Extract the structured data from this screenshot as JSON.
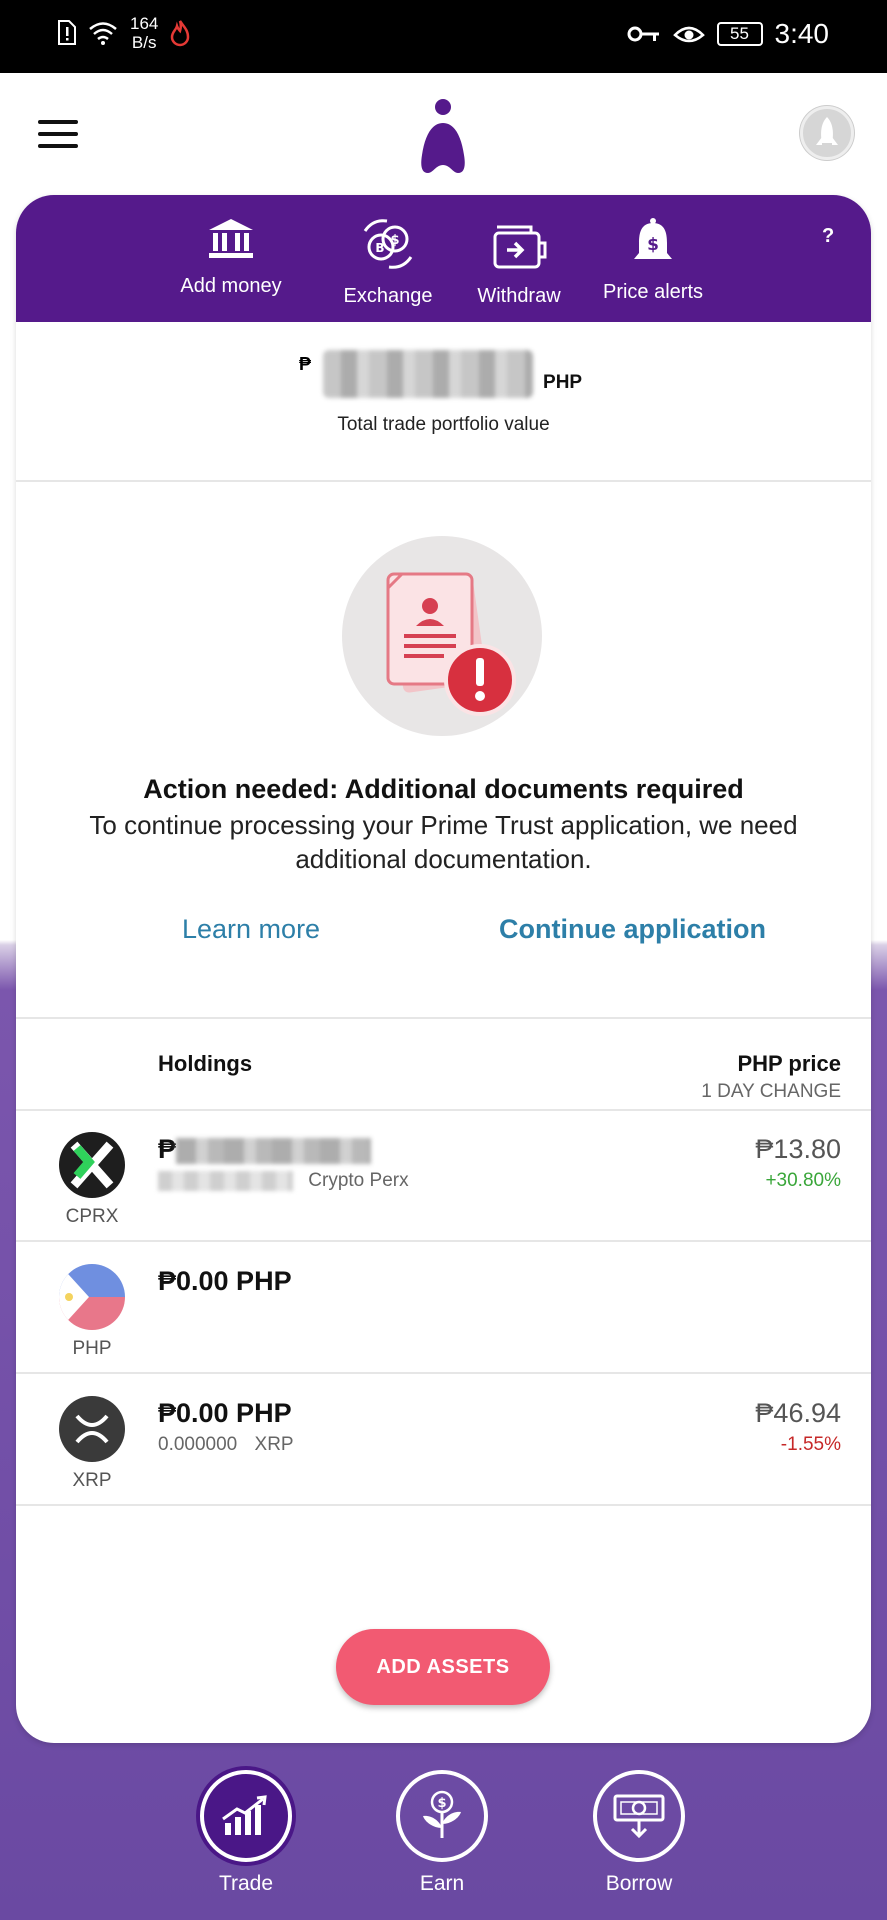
{
  "status_bar": {
    "net_speed_value": "164",
    "net_speed_unit": "B/s",
    "battery": "55",
    "time": "3:40"
  },
  "header": {
    "menu_icon": "hamburger-icon",
    "logo_icon": "app-logo",
    "profile_icon": "avatar"
  },
  "quick_actions": [
    {
      "label": "Add money",
      "icon": "bank-icon"
    },
    {
      "label": "Exchange",
      "icon": "exchange-icon"
    },
    {
      "label": "Withdraw",
      "icon": "withdraw-icon"
    },
    {
      "label": "Price alerts",
      "icon": "bell-dollar-icon"
    }
  ],
  "help_label": "?",
  "portfolio": {
    "currency_symbol": "₱",
    "currency": "PHP",
    "label": "Total trade portfolio value"
  },
  "notice": {
    "title": "Action needed: Additional documents required",
    "body": "To continue processing your Prime Trust application, we need additional documentation.",
    "learn_more": "Learn more",
    "continue": "Continue application"
  },
  "holdings": {
    "title": "Holdings",
    "price_header": "PHP price",
    "change_header": "1 DAY CHANGE",
    "rows": [
      {
        "ticker": "CPRX",
        "amount": "₱",
        "sub_name": "Crypto Perx",
        "price": "₱13.80",
        "change": "+30.80%",
        "direction": "up"
      },
      {
        "ticker": "PHP",
        "amount": "₱0.00 PHP",
        "sub_name": "",
        "price": "",
        "change": "",
        "direction": ""
      },
      {
        "ticker": "XRP",
        "amount": "₱0.00 PHP",
        "sub_qty": "0.000000",
        "sub_name": "XRP",
        "price": "₱46.94",
        "change": "-1.55%",
        "direction": "down"
      }
    ]
  },
  "add_assets_label": "ADD ASSETS",
  "bottom_nav": [
    {
      "label": "Trade",
      "icon": "chart-up-icon",
      "active": true
    },
    {
      "label": "Earn",
      "icon": "plant-coin-icon",
      "active": false
    },
    {
      "label": "Borrow",
      "icon": "cash-icon",
      "active": false
    }
  ],
  "colors": {
    "brand_purple": "#551a8b",
    "accent_pink": "#f25a72",
    "link_blue": "#2d7fa8",
    "positive": "#3aa63a",
    "negative": "#c62828"
  }
}
